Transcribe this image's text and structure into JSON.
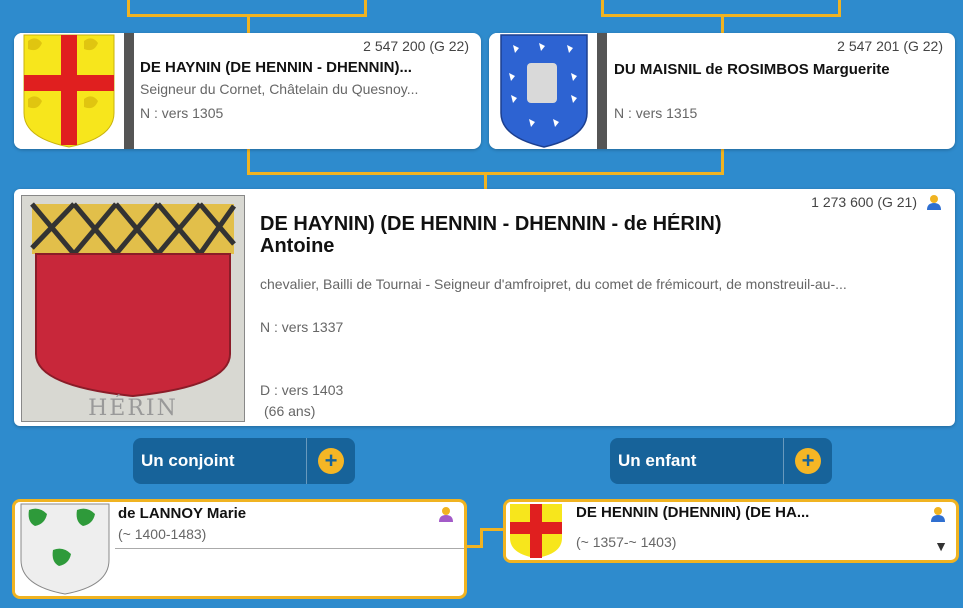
{
  "father": {
    "sosa": "2 547 200 (G 22)",
    "name": "DE HAYNIN (DE HENNIN - DHENNIN)...",
    "title": "Seigneur du Cornet, Châtelain du Quesnoy...",
    "birth": "N : vers 1305",
    "crest_icon": "red-cross-yellow-shield-icon"
  },
  "mother": {
    "sosa": "2 547 201 (G 22)",
    "name": "DU MAISNIL de ROSIMBOS Marguerite",
    "birth": "N : vers 1315",
    "crest_icon": "blue-shield-silver-birds-icon"
  },
  "main_person": {
    "sosa": "1 273 600 (G 21)",
    "surname": "DE HAYNIN) (DE HENNIN - DHENNIN - de HÉRIN)",
    "firstname": "Antoine",
    "titles": "chevalier, Bailli de Tournai - Seigneur d'amfroipret, du comet de frémicourt, de monstreuil-au-...",
    "birth": "N : vers 1337",
    "death": "D : vers 1403",
    "age": "(66 ans)",
    "crest_caption": "HÉRIN",
    "colors": {
      "male": "#2f6fd0",
      "female": "#a35bc8",
      "accent": "#f0b321"
    }
  },
  "buttons": {
    "spouse_label": "Un conjoint",
    "child_label": "Un enfant",
    "plus_label": "+"
  },
  "spouse": {
    "name": "de LANNOY Marie",
    "dates": "(~ 1400-1483)"
  },
  "child": {
    "name": "DE HENNIN (DHENNIN) (DE HA...",
    "dates": "(~ 1357-~ 1403)",
    "expand_glyph": "▼"
  }
}
